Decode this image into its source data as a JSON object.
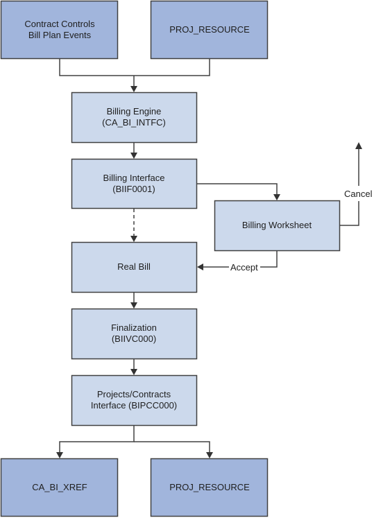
{
  "diagram": {
    "colors": {
      "source_box_fill": "#a1b5dc",
      "process_box_fill": "#ccd9ec",
      "stroke": "#404040"
    },
    "nodes": {
      "contract_controls": {
        "lines": [
          "Contract Controls",
          "Bill Plan Events"
        ]
      },
      "proj_resource_top": {
        "lines": [
          "PROJ_RESOURCE"
        ]
      },
      "billing_engine": {
        "lines": [
          "Billing Engine",
          "(CA_BI_INTFC)"
        ]
      },
      "billing_interface": {
        "lines": [
          "Billing Interface",
          "(BIIF0001)"
        ]
      },
      "billing_worksheet": {
        "lines": [
          "Billing Worksheet"
        ]
      },
      "real_bill": {
        "lines": [
          "Real Bill"
        ]
      },
      "finalization": {
        "lines": [
          "Finalization",
          "(BIIVC000)"
        ]
      },
      "projects_contracts_interface": {
        "lines": [
          "Projects/Contracts",
          "Interface (BIPCC000)"
        ]
      },
      "ca_bi_xref": {
        "lines": [
          "CA_BI_XREF"
        ]
      },
      "proj_resource_bottom": {
        "lines": [
          "PROJ_RESOURCE"
        ]
      }
    },
    "edge_labels": {
      "accept": "Accept",
      "cancel": "Cancel"
    }
  }
}
